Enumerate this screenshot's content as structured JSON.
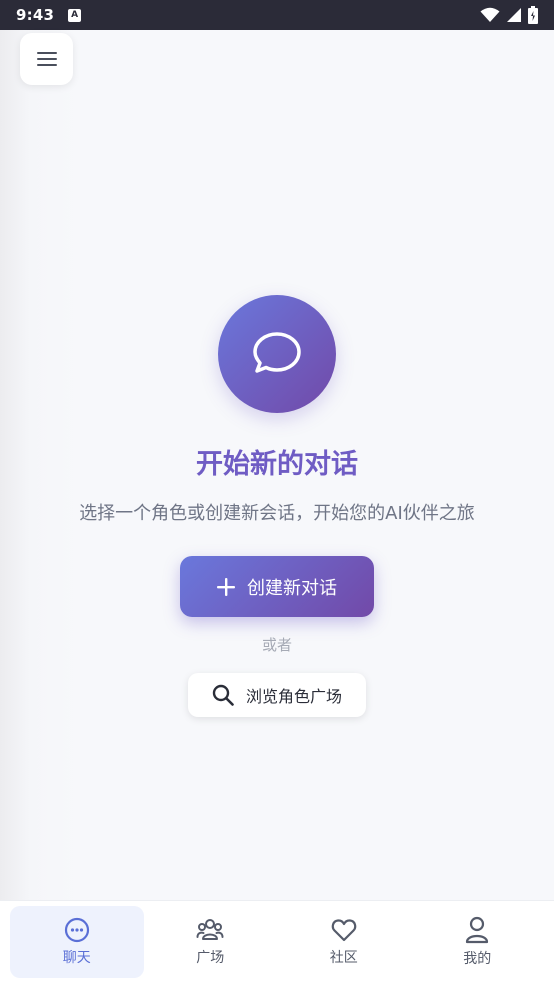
{
  "status_bar": {
    "time": "9:43",
    "notification_icon_letter": "A",
    "icons": [
      "wifi-icon",
      "signal-icon",
      "battery-icon"
    ]
  },
  "header": {
    "menu_icon": "hamburger-menu-icon"
  },
  "empty_state": {
    "icon": "chat-bubble-icon",
    "title": "开始新的对话",
    "subtitle": "选择一个角色或创建新会话，开始您的AI伙伴之旅",
    "create_button_label": "创建新对话",
    "or_text": "或者",
    "browse_button_label": "浏览角色广场"
  },
  "bottom_nav": {
    "items": [
      {
        "label": "聊天",
        "icon": "chat-dots-icon",
        "active": true
      },
      {
        "label": "广场",
        "icon": "group-icon",
        "active": false
      },
      {
        "label": "社区",
        "icon": "heart-icon",
        "active": false
      },
      {
        "label": "我的",
        "icon": "user-icon",
        "active": false
      }
    ]
  },
  "colors": {
    "accent_start": "#6a78dc",
    "accent_end": "#7249a8",
    "title": "#6f5cc4",
    "nav_active": "#5a6fd6"
  }
}
